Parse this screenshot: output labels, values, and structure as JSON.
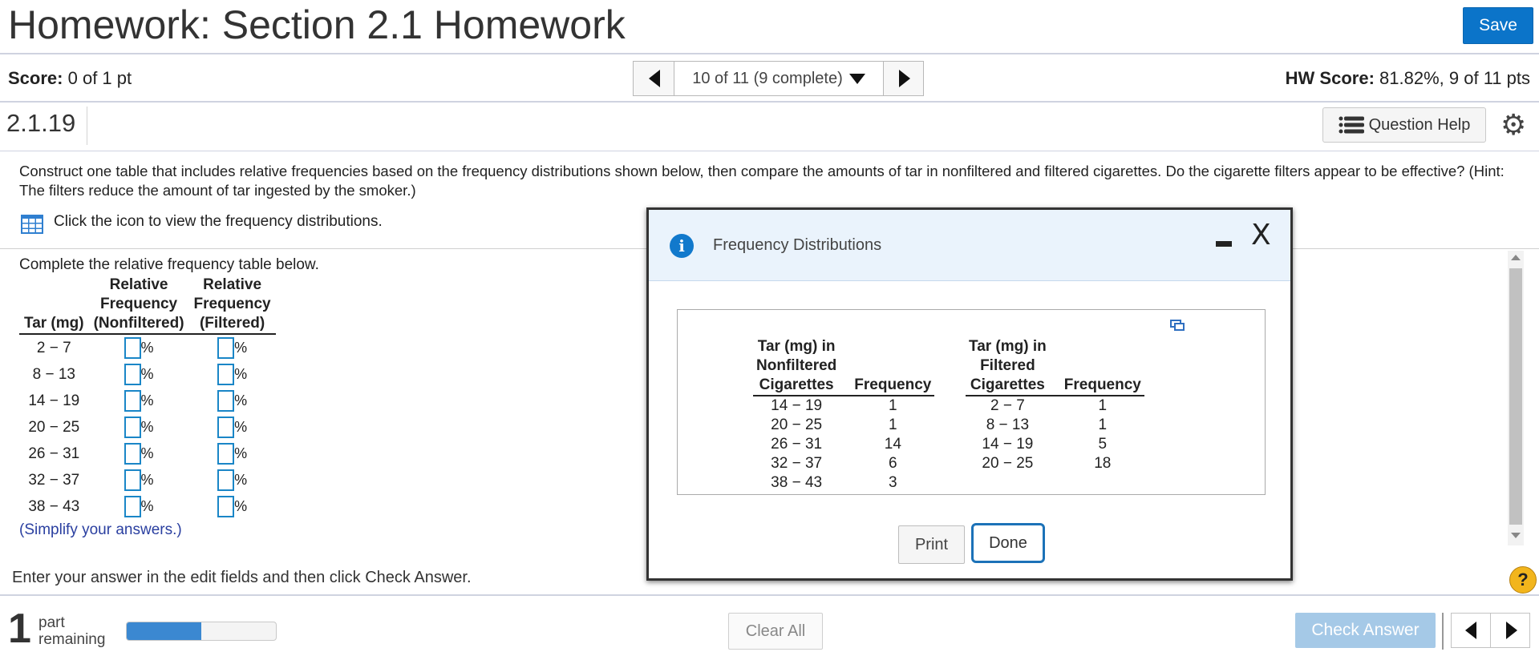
{
  "header": {
    "title": "Homework: Section 2.1 Homework",
    "save_label": "Save"
  },
  "status": {
    "score_label": "Score:",
    "score_value": "0 of 1 pt",
    "question_position": "10 of 11 (9 complete)",
    "hw_score_label": "HW Score:",
    "hw_score_value": "81.82%, 9 of 11 pts"
  },
  "question_bar": {
    "number": "2.1.19",
    "help_label": "Question Help"
  },
  "question": {
    "text": "Construct one table that includes relative frequencies based on the frequency distributions shown below, then compare the amounts of tar in nonfiltered and filtered cigarettes. Do the cigarette filters appear to be effective? (Hint: The filters reduce the amount of tar ingested by the smoker.)",
    "click_icon_text": "Click the icon to view the frequency distributions.",
    "complete_text": "Complete the relative frequency table below.",
    "table_headers": {
      "col1_line3": "Tar (mg)",
      "col2_line1": "Relative",
      "col2_line2": "Frequency",
      "col2_line3": "(Nonfiltered)",
      "col3_line1": "Relative",
      "col3_line2": "Frequency",
      "col3_line3": "(Filtered)"
    },
    "rows": [
      "2 − 7",
      "8 − 13",
      "14 − 19",
      "20 − 25",
      "26 − 31",
      "32 − 37",
      "38 − 43"
    ],
    "percent_sign": "%",
    "simplify_text": "(Simplify your answers.)",
    "instruction": "Enter your answer in the edit fields and then click Check Answer."
  },
  "footer": {
    "parts_count": "1",
    "parts_label_1": "part",
    "parts_label_2": "remaining",
    "progress_fraction": 0.5,
    "clear_all_label": "Clear All",
    "check_answer_label": "Check Answer",
    "help_symbol": "?"
  },
  "modal": {
    "title": "Frequency Distributions",
    "close_symbol": "X",
    "nonfiltered": {
      "header_1": "Tar (mg) in",
      "header_2": "Nonfiltered",
      "header_3": "Cigarettes",
      "freq_header": "Frequency",
      "rows": [
        {
          "range": "14 − 19",
          "freq": "1"
        },
        {
          "range": "20 − 25",
          "freq": "1"
        },
        {
          "range": "26 − 31",
          "freq": "14"
        },
        {
          "range": "32 − 37",
          "freq": "6"
        },
        {
          "range": "38 − 43",
          "freq": "3"
        }
      ]
    },
    "filtered": {
      "header_1": "Tar (mg) in",
      "header_2": "Filtered",
      "header_3": "Cigarettes",
      "freq_header": "Frequency",
      "rows": [
        {
          "range": "2 − 7",
          "freq": "1"
        },
        {
          "range": "8 − 13",
          "freq": "1"
        },
        {
          "range": "14 − 19",
          "freq": "5"
        },
        {
          "range": "20 − 25",
          "freq": "18"
        }
      ]
    },
    "print_label": "Print",
    "done_label": "Done"
  },
  "colors": {
    "accent": "#0b74c9",
    "check_answer_disabled": "#a5c9e7",
    "input_border": "#1a86c7",
    "progress_fill": "#3b88d1"
  }
}
